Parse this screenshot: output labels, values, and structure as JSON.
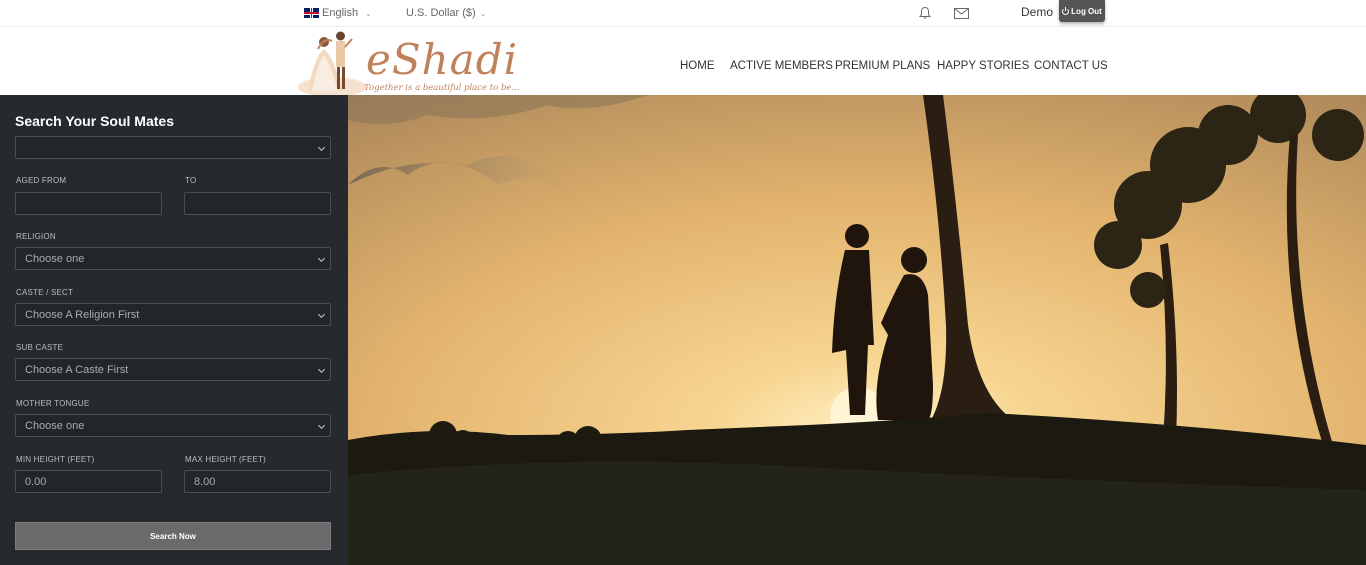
{
  "topbar": {
    "language": "English",
    "currency": "U.S. Dollar ($)",
    "username": "Demo",
    "logout_label": "Log Out",
    "icons": [
      "uk-flag-icon",
      "bell-icon",
      "mail-icon",
      "power-icon"
    ]
  },
  "header": {
    "logo_text": "eShadi",
    "tagline": "Together is a beautiful place to be...",
    "nav": [
      "HOME",
      "ACTIVE MEMBERS",
      "PREMIUM PLANS",
      "HAPPY STORIES",
      "CONTACT US"
    ],
    "active_nav": "HOME"
  },
  "search": {
    "title": "Search Your Soul Mates",
    "profile_select_value": "",
    "aged_from_label": "AGED FROM",
    "to_label": "TO",
    "aged_from_value": "",
    "to_value": "",
    "religion_label": "RELIGION",
    "religion_value": "Choose one",
    "caste_label": "CASTE / SECT",
    "caste_value": "Choose A Religion First",
    "subcaste_label": "SUB CASTE",
    "subcaste_value": "Choose A Caste First",
    "tongue_label": "MOTHER TONGUE",
    "tongue_value": "Choose one",
    "min_height_label": "MIN HEIGHT (FEET)",
    "max_height_label": "MAX HEIGHT (FEET)",
    "min_height_value": "0.00",
    "max_height_value": "8.00",
    "button_label": "Search Now"
  },
  "colors": {
    "sidebar_bg": "#262a2e",
    "brand": "#c0825a",
    "button_bg": "#6b6a6a"
  }
}
